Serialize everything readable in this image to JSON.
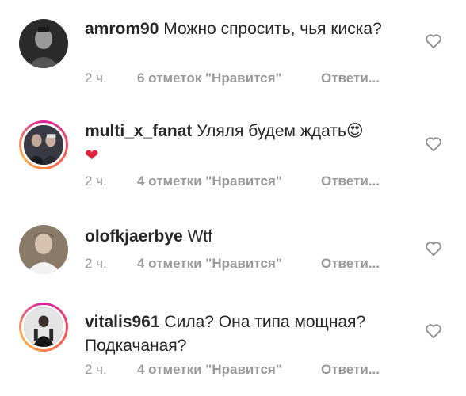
{
  "comments": [
    {
      "username": "amrom90",
      "text": "Можно спросить, чья киска?",
      "time": "2 ч.",
      "likes": "6 отметок \"Нравится\"",
      "reply": "Ответи...",
      "avatar_icon": "user-avatar-dark",
      "story_ring": false
    },
    {
      "username": "multi_x_fanat",
      "text": "Уляля будем ждать",
      "emojis": [
        "😍",
        "❤"
      ],
      "time": "2 ч.",
      "likes": "4 отметки \"Нравится\"",
      "reply": "Ответи...",
      "avatar_icon": "user-avatar-group",
      "story_ring": true
    },
    {
      "username": "olofkjaerbye",
      "text": "Wtf",
      "time": "2 ч.",
      "likes": "4 отметки \"Нравится\"",
      "reply": "Ответи...",
      "avatar_icon": "user-avatar-light",
      "story_ring": false
    },
    {
      "username": "vitalis961",
      "text": "Сила? Она типа мощная? Подкачаная?",
      "time": "2 ч.",
      "likes": "4 отметки \"Нравится\"",
      "reply": "Ответи...",
      "avatar_icon": "user-avatar-dark-figure",
      "story_ring": true
    }
  ],
  "colors": {
    "text": "#262626",
    "meta": "#999999",
    "story_ring": "#d6249f",
    "heart_emoji": "#e0213c"
  }
}
